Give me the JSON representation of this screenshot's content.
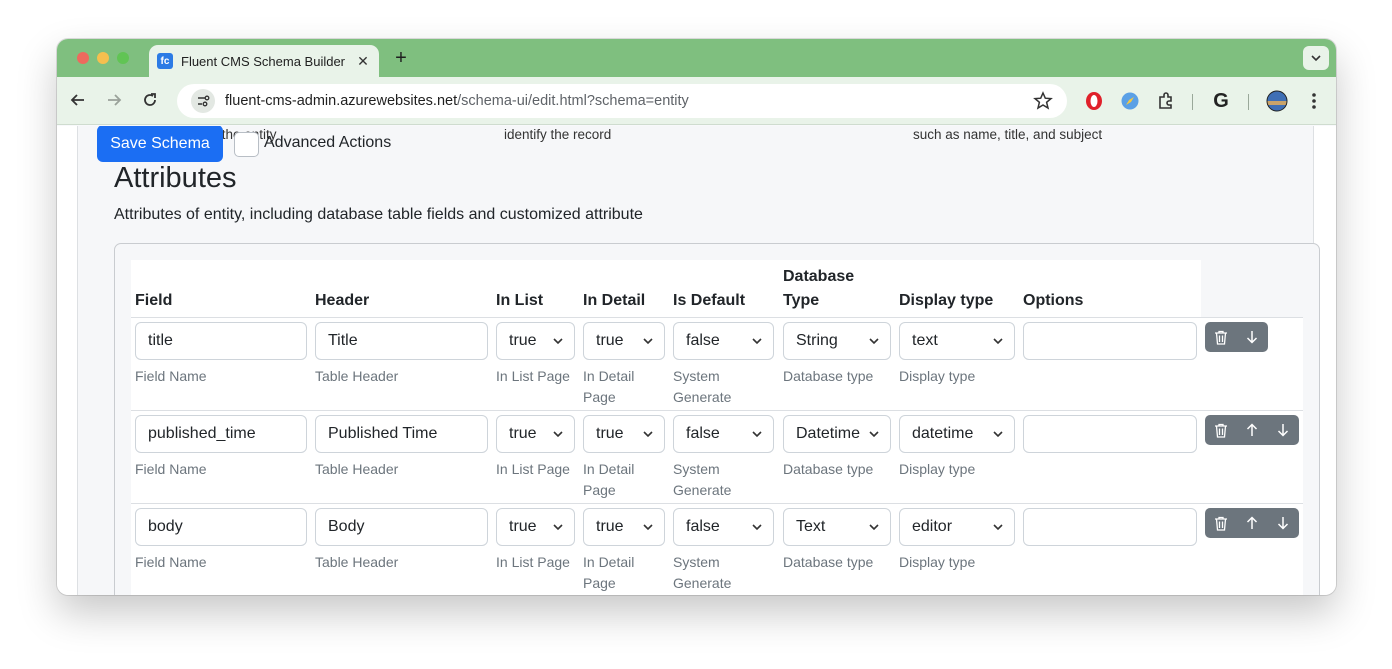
{
  "browser": {
    "tab_title": "Fluent CMS Schema Builder",
    "favicon_text": "fc",
    "url_host": "fluent-cms-admin.azurewebsites.net",
    "url_path": "/schema-ui/edit.html?schema=entity"
  },
  "page": {
    "hint_left": "store the entity",
    "hint_mid": "identify the record",
    "hint_right": "such as name, title, and subject",
    "save_label": "Save Schema",
    "advanced_label": "Advanced Actions",
    "advanced_checked": false,
    "heading": "Attributes",
    "description": "Attributes of entity, including database table fields and customized attribute"
  },
  "table": {
    "headers": {
      "field": "Field",
      "header": "Header",
      "in_list": "In List",
      "in_detail": "In Detail",
      "is_default": "Is Default",
      "db_type_line1": "Database",
      "db_type_line2": "Type",
      "display_type": "Display type",
      "options": "Options"
    },
    "captions": {
      "field": "Field Name",
      "header": "Table Header",
      "in_list": "In List Page",
      "in_detail": "In Detail Page",
      "is_default": "System Generate",
      "db_type": "Database type",
      "display_type": "Display type"
    },
    "rows": [
      {
        "field": "title",
        "header": "Title",
        "in_list": "true",
        "in_detail": "true",
        "is_default": "false",
        "db_type": "String",
        "display_type": "text",
        "options": ""
      },
      {
        "field": "published_time",
        "header": "Published Time",
        "in_list": "true",
        "in_detail": "true",
        "is_default": "false",
        "db_type": "Datetime",
        "display_type": "datetime",
        "options": ""
      },
      {
        "field": "body",
        "header": "Body",
        "in_list": "true",
        "in_detail": "true",
        "is_default": "false",
        "db_type": "Text",
        "display_type": "editor",
        "options": ""
      }
    ]
  },
  "colors": {
    "tabstrip": "#7fbf7f",
    "toolbar": "#e9f3e9",
    "primary": "#1b6ef3",
    "action_group": "#6c757d"
  },
  "icons": {
    "back": "arrow-left-icon",
    "forward": "arrow-right-icon",
    "reload": "reload-icon",
    "star": "star-icon",
    "delete": "trash-icon",
    "up": "arrow-up-icon",
    "down": "arrow-down-icon"
  }
}
